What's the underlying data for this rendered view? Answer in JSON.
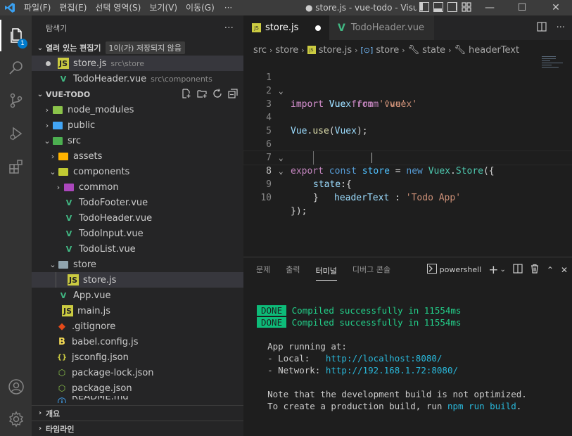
{
  "titlebar": {
    "menus": [
      "파일(F)",
      "편집(E)",
      "선택 영역(S)",
      "보기(V)",
      "이동(G)"
    ],
    "more": "···",
    "window_title": "● store.js - vue-todo - Visua...",
    "minimize": "—",
    "maximize": "☐",
    "close": "✕"
  },
  "activity": {
    "badge": "1"
  },
  "sidebar": {
    "title": "탐색기",
    "more": "···",
    "open_editors": {
      "label": "열려 있는 편집기",
      "unsaved": "1이(가) 저장되지 않음",
      "items": [
        {
          "name": "store.js",
          "desc": "src\\store"
        },
        {
          "name": "TodoHeader.vue",
          "desc": "src\\components"
        }
      ]
    },
    "project": {
      "label": "VUE-TODO",
      "tree": [
        {
          "name": "node_modules"
        },
        {
          "name": "public"
        },
        {
          "name": "src"
        },
        {
          "name": "assets"
        },
        {
          "name": "components"
        },
        {
          "name": "common"
        },
        {
          "name": "TodoFooter.vue"
        },
        {
          "name": "TodoHeader.vue"
        },
        {
          "name": "TodoInput.vue"
        },
        {
          "name": "TodoList.vue"
        },
        {
          "name": "store"
        },
        {
          "name": "store.js"
        },
        {
          "name": "App.vue"
        },
        {
          "name": "main.js"
        },
        {
          "name": ".gitignore"
        },
        {
          "name": "babel.config.js"
        },
        {
          "name": "jsconfig.json"
        },
        {
          "name": "package-lock.json"
        },
        {
          "name": "package.json"
        },
        {
          "name": "README.md"
        }
      ]
    },
    "outline": "개요",
    "timeline": "타임라인"
  },
  "tabs": [
    {
      "label": "store.js",
      "icon": "JS"
    },
    {
      "label": "TodoHeader.vue"
    }
  ],
  "breadcrumbs": [
    "src",
    "store",
    "store.js",
    "store",
    "state",
    "headerText"
  ],
  "editor": {
    "line_numbers": [
      "1",
      "2",
      "3",
      "4",
      "5",
      "6",
      "7",
      "8",
      "9",
      "10"
    ],
    "current_line": 8,
    "lines": {
      "l1": {
        "k": "import",
        "a": "Vue",
        "f": "from",
        "s": "'vue'"
      },
      "l2": {
        "k": "import",
        "a": "Vuex",
        "f": "from",
        "s": "'vuex'"
      },
      "l4": {
        "a": "Vue",
        "d": ".",
        "m": "use",
        "o": "(",
        "b": "Vuex",
        "c": ");"
      },
      "l6": {
        "k": "export",
        "c1": "const",
        "v": "store",
        "eq": " = ",
        "n": "new",
        "x": "Vuex",
        "d": ".",
        "st": "Store",
        "o": "({"
      },
      "l7": {
        "p": "state",
        "o": ":{"
      },
      "l8": {
        "p": "headerText",
        "c": " : ",
        "s": "'Todo App'"
      },
      "l9": {
        "c": "}"
      },
      "l10": {
        "c": "});"
      }
    }
  },
  "panel": {
    "tabs": [
      "문제",
      "출력",
      "터미널",
      "디버그 콘솔"
    ],
    "active_tab": "터미널",
    "shell": "powershell",
    "terminal": {
      "done": "DONE",
      "compiled": "Compiled successfully in 11554ms",
      "app_running": "App running at:",
      "local_label": "- Local:   ",
      "local_url": "http://localhost:8080/",
      "network_label": "- Network: ",
      "network_url": "http://192.168.1.72:8080/",
      "note": "Note that the development build is not optimized.",
      "prod_prefix": "To create a production build, run ",
      "prod_cmd": "npm run build",
      "prod_suffix": "."
    }
  },
  "colors": {
    "accent": "#007acc",
    "js": "#cbcb41",
    "vue": "#41b883",
    "done_bg": "#0dbc79"
  }
}
